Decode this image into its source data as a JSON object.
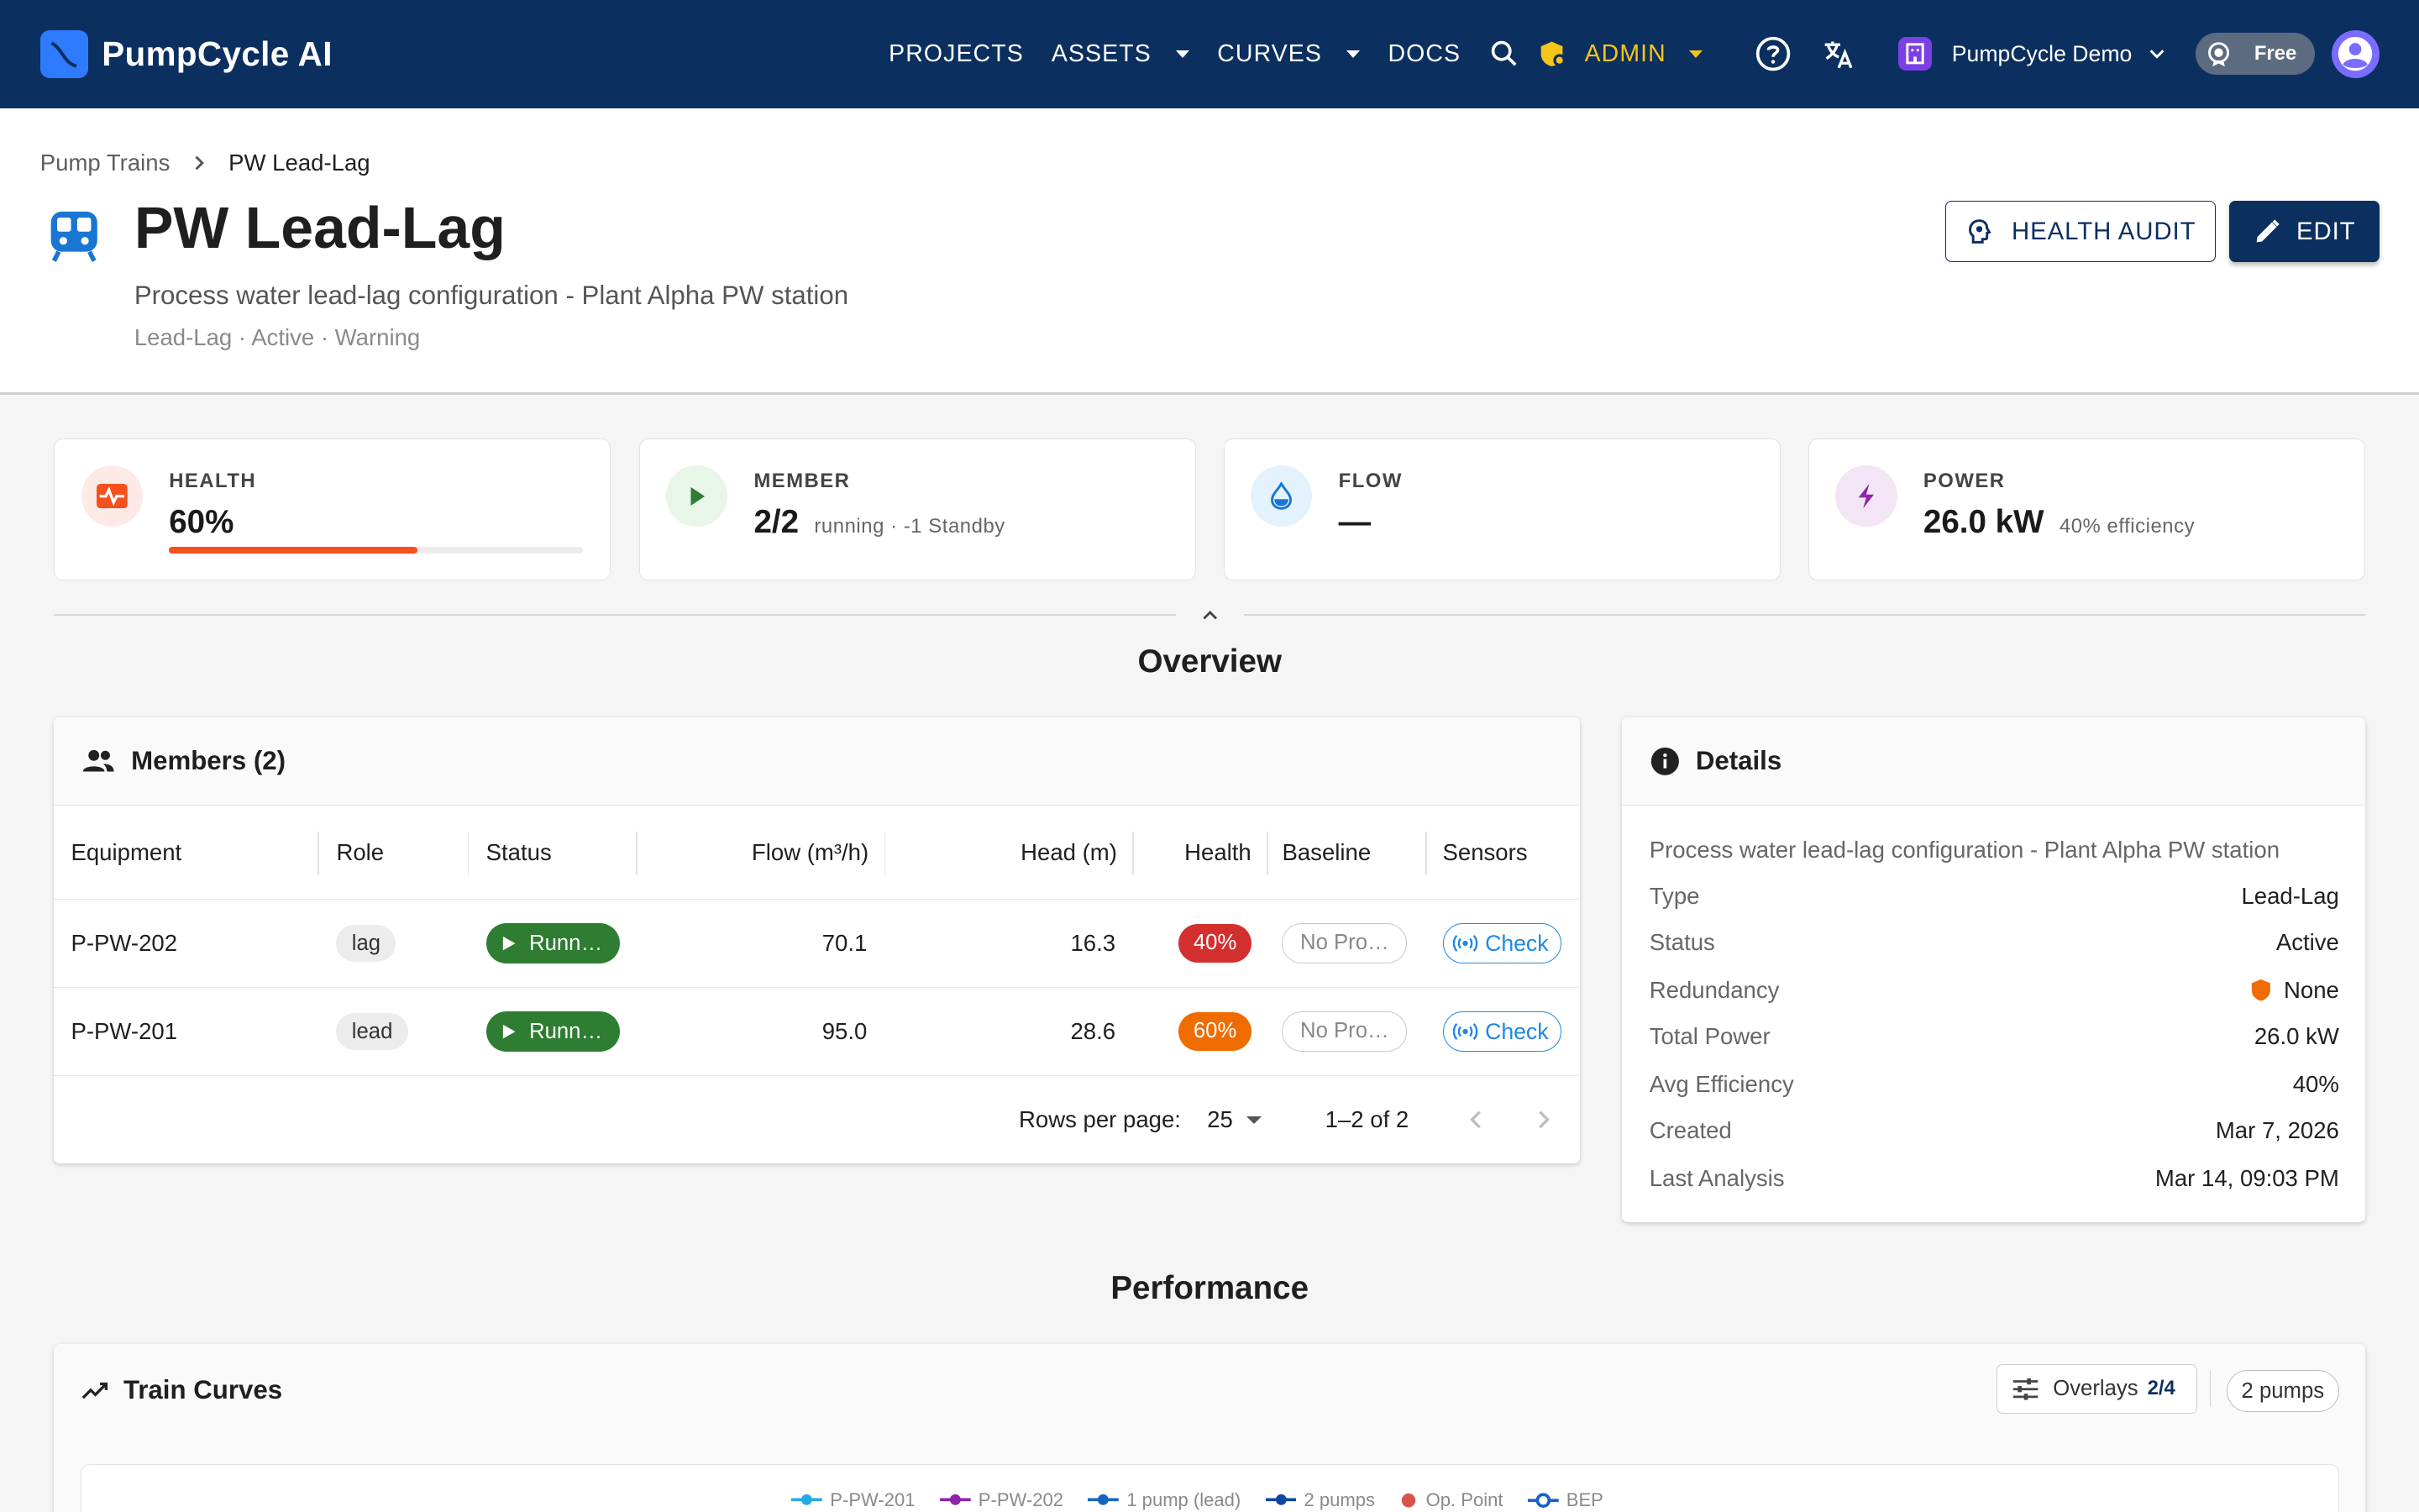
{
  "app": {
    "name": "PumpCycle AI"
  },
  "nav": {
    "projects": "PROJECTS",
    "assets": "ASSETS",
    "curves": "CURVES",
    "docs": "DOCS",
    "admin": "ADMIN",
    "org_name": "PumpCycle Demo",
    "plan": "Free"
  },
  "breadcrumb": {
    "root": "Pump Trains",
    "current": "PW Lead-Lag"
  },
  "page": {
    "title": "PW Lead-Lag",
    "subtitle": "Process water lead-lag configuration - Plant Alpha PW station",
    "meta": "Lead-Lag · Active · Warning",
    "health_audit_label": "HEALTH AUDIT",
    "edit_label": "EDIT"
  },
  "stats": {
    "health": {
      "label": "HEALTH",
      "value": "60%",
      "fraction": 0.6
    },
    "member": {
      "label": "MEMBER",
      "value": "2/2",
      "extra": "running · -1 Standby"
    },
    "flow": {
      "label": "FLOW",
      "value": "—"
    },
    "power": {
      "label": "POWER",
      "value": "26.0 kW",
      "extra": "40% efficiency"
    }
  },
  "sections": {
    "overview": "Overview",
    "performance": "Performance"
  },
  "members": {
    "title": "Members (2)",
    "columns": [
      "Equipment",
      "Role",
      "Status",
      "Flow (m³/h)",
      "Head (m)",
      "Health",
      "Baseline",
      "Sensors"
    ],
    "rows": [
      {
        "equipment": "P-PW-202",
        "role": "lag",
        "status": "Runn…",
        "flow": "70.1",
        "head": "16.3",
        "health": "40%",
        "baseline": "No Pro…",
        "sensors": "Check"
      },
      {
        "equipment": "P-PW-201",
        "role": "lead",
        "status": "Runn…",
        "flow": "95.0",
        "head": "28.6",
        "health": "60%",
        "baseline": "No Pro…",
        "sensors": "Check"
      }
    ],
    "rows_per_page_label": "Rows per page:",
    "rows_per_page": "25",
    "range": "1–2 of 2"
  },
  "details": {
    "title": "Details",
    "description": "Process water lead-lag configuration - Plant Alpha PW station",
    "rows": [
      {
        "key": "Type",
        "value": "Lead-Lag"
      },
      {
        "key": "Status",
        "value": "Active"
      },
      {
        "key": "Redundancy",
        "value": "None"
      },
      {
        "key": "Total Power",
        "value": "26.0 kW"
      },
      {
        "key": "Avg Efficiency",
        "value": "40%"
      },
      {
        "key": "Created",
        "value": "Mar 7, 2026"
      },
      {
        "key": "Last Analysis",
        "value": "Mar 14, 09:03 PM"
      }
    ]
  },
  "curves": {
    "title": "Train Curves",
    "overlays_label": "Overlays",
    "overlays_count": "2/4",
    "pumps_label": "2 pumps",
    "legend": [
      "P-PW-201",
      "P-PW-202",
      "1 pump (lead)",
      "2 pumps",
      "Op. Point",
      "BEP"
    ]
  },
  "colors": {
    "brand_navy": "#0b2f5f",
    "admin_yellow": "#f5c518",
    "running_green": "#2e7d32",
    "health_red": "#d32f2f",
    "health_orange": "#ef6c00",
    "health_bar": "#f4511e",
    "sensor_blue": "#1e88e5"
  }
}
